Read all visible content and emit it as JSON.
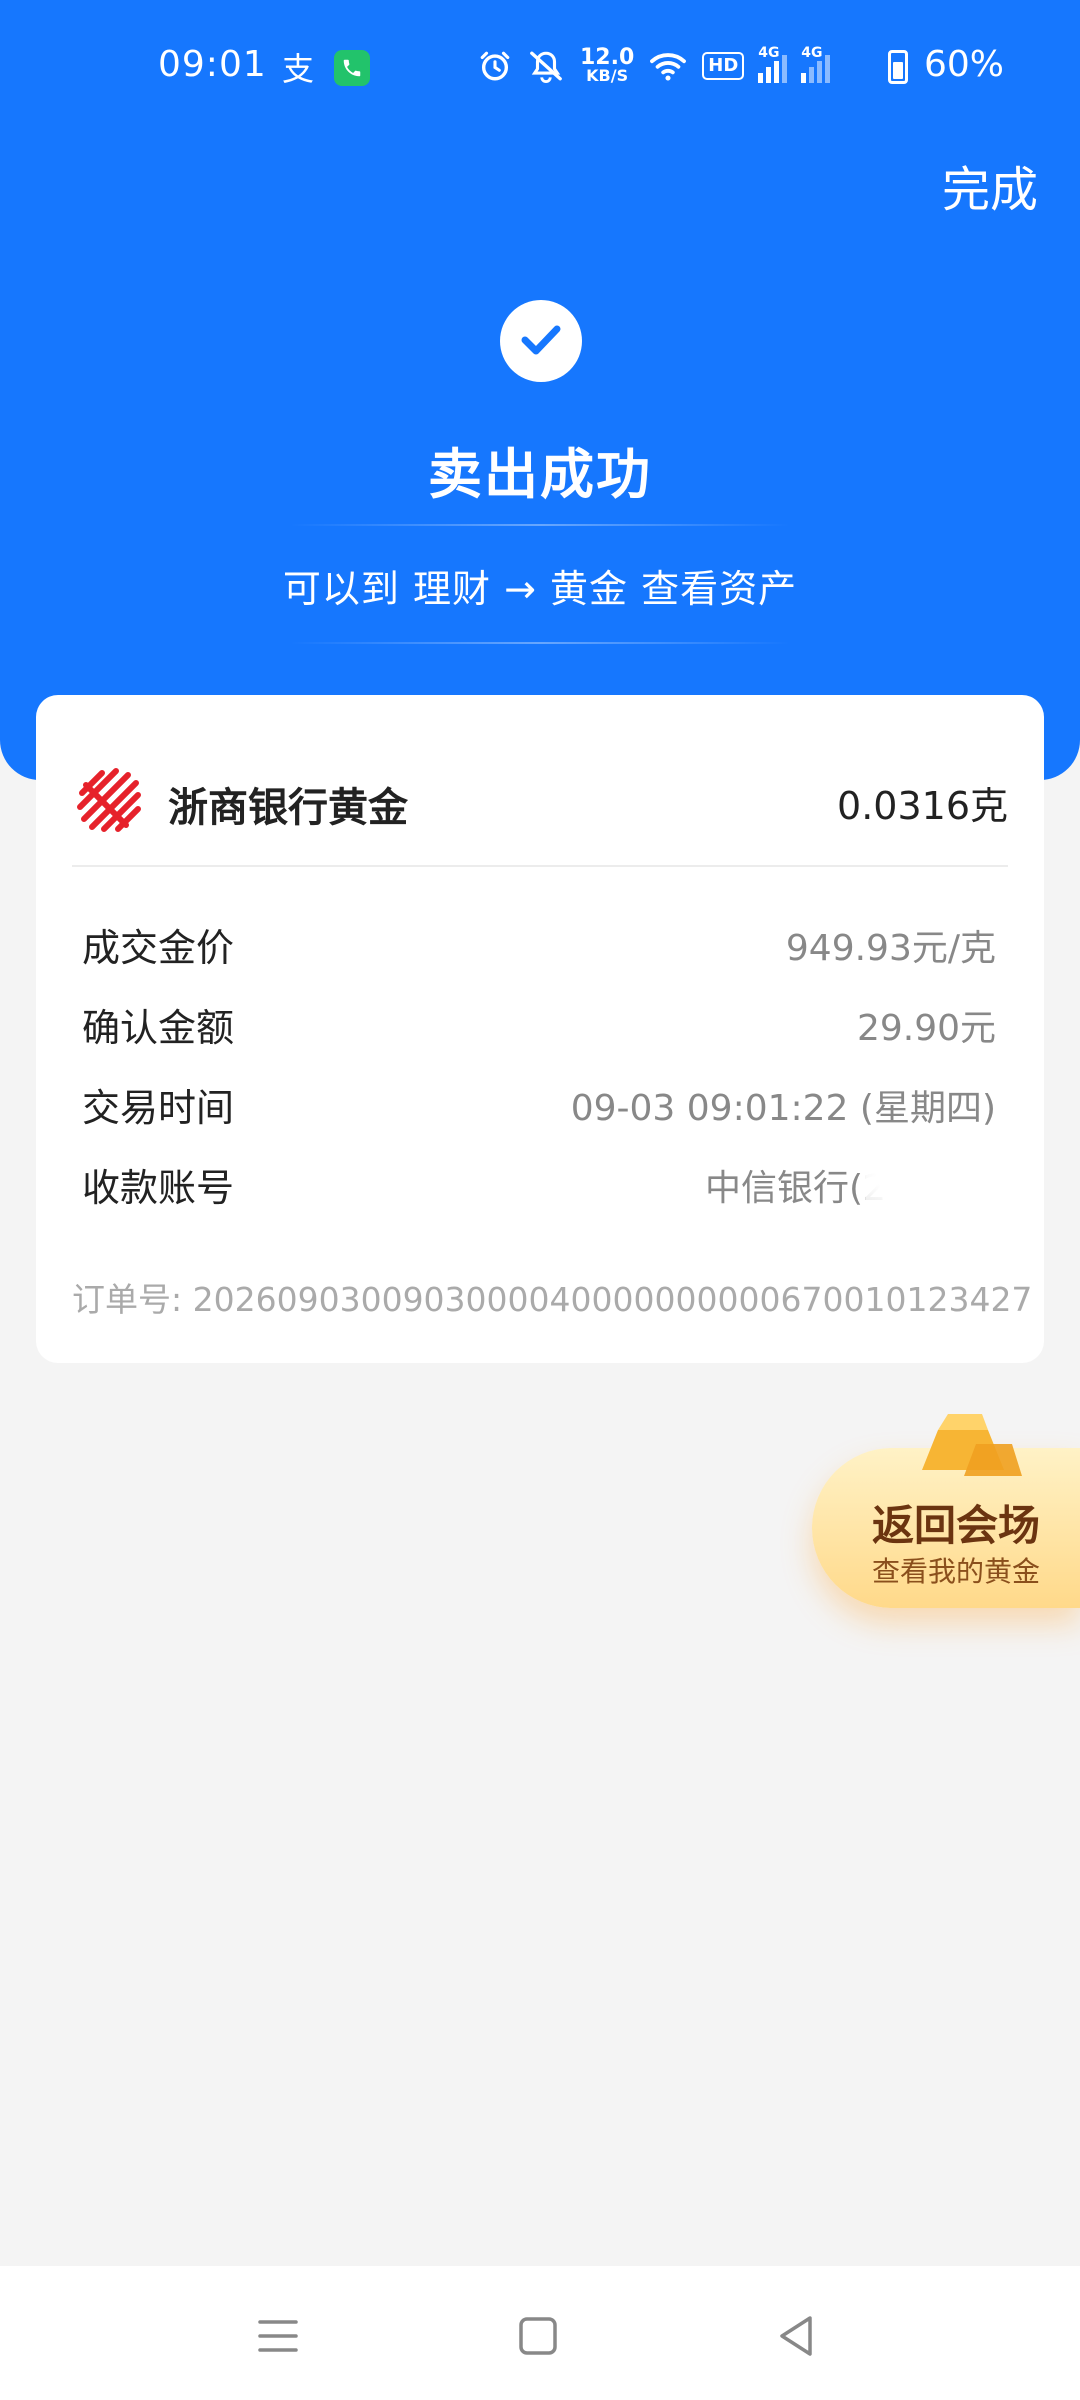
{
  "status_bar": {
    "time": "09:01",
    "alipay_glyph": "支",
    "speed_top": "12.0",
    "speed_bottom": "KB/S",
    "hd_label": "HD",
    "network_1": "4G",
    "network_2": "4G",
    "battery": "60%"
  },
  "header": {
    "done_label": "完成",
    "title": "卖出成功",
    "subtitle": "可以到 理财 → 黄金 查看资产"
  },
  "card": {
    "bank_name": "浙商银行黄金",
    "gold_amount": "0.0316克",
    "rows": [
      {
        "label": "成交金价",
        "value": "949.93元/克"
      },
      {
        "label": "确认金额",
        "value": "29.90元"
      },
      {
        "label": "交易时间",
        "value": "09-03 09:01:22 (星期四)"
      },
      {
        "label": "收款账号",
        "value": "中信银行(2"
      }
    ],
    "order_label": "订单号: 2026090300903000040000000000670010123427"
  },
  "promo": {
    "title": "返回会场",
    "subtitle": "查看我的黄金"
  },
  "colors": {
    "primary": "#1677fe",
    "bank_red": "#e6222b",
    "promo_text": "#6b3410"
  }
}
